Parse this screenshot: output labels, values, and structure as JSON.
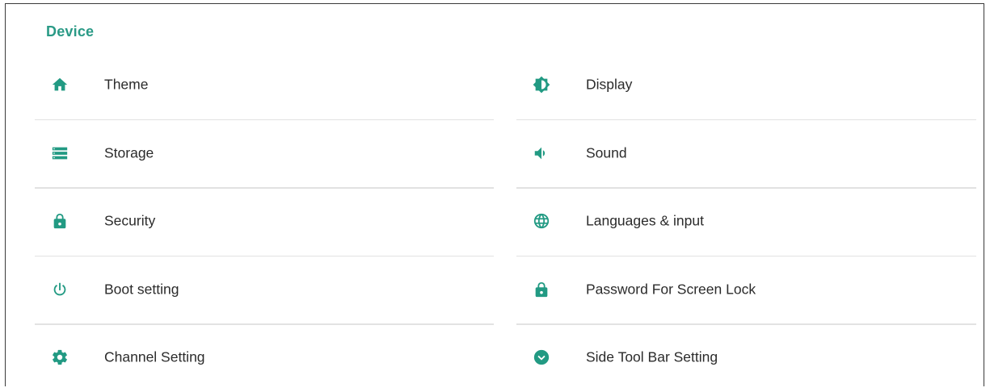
{
  "section": {
    "title": "Device"
  },
  "left_items": [
    {
      "label": "Theme",
      "icon": "home-icon"
    },
    {
      "label": "Storage",
      "icon": "storage-icon"
    },
    {
      "label": "Security",
      "icon": "lock-icon"
    },
    {
      "label": "Boot setting",
      "icon": "power-icon"
    },
    {
      "label": "Channel Setting",
      "icon": "gear-icon"
    }
  ],
  "right_items": [
    {
      "label": "Display",
      "icon": "brightness-icon"
    },
    {
      "label": "Sound",
      "icon": "volume-icon"
    },
    {
      "label": "Languages & input",
      "icon": "globe-icon"
    },
    {
      "label": "Password For Screen Lock",
      "icon": "lock-icon"
    },
    {
      "label": "Side Tool Bar Setting",
      "icon": "chevron-circle-icon"
    }
  ],
  "colors": {
    "accent": "#229a83",
    "divider": "#e2e2e2",
    "text": "#2b2b2b"
  }
}
